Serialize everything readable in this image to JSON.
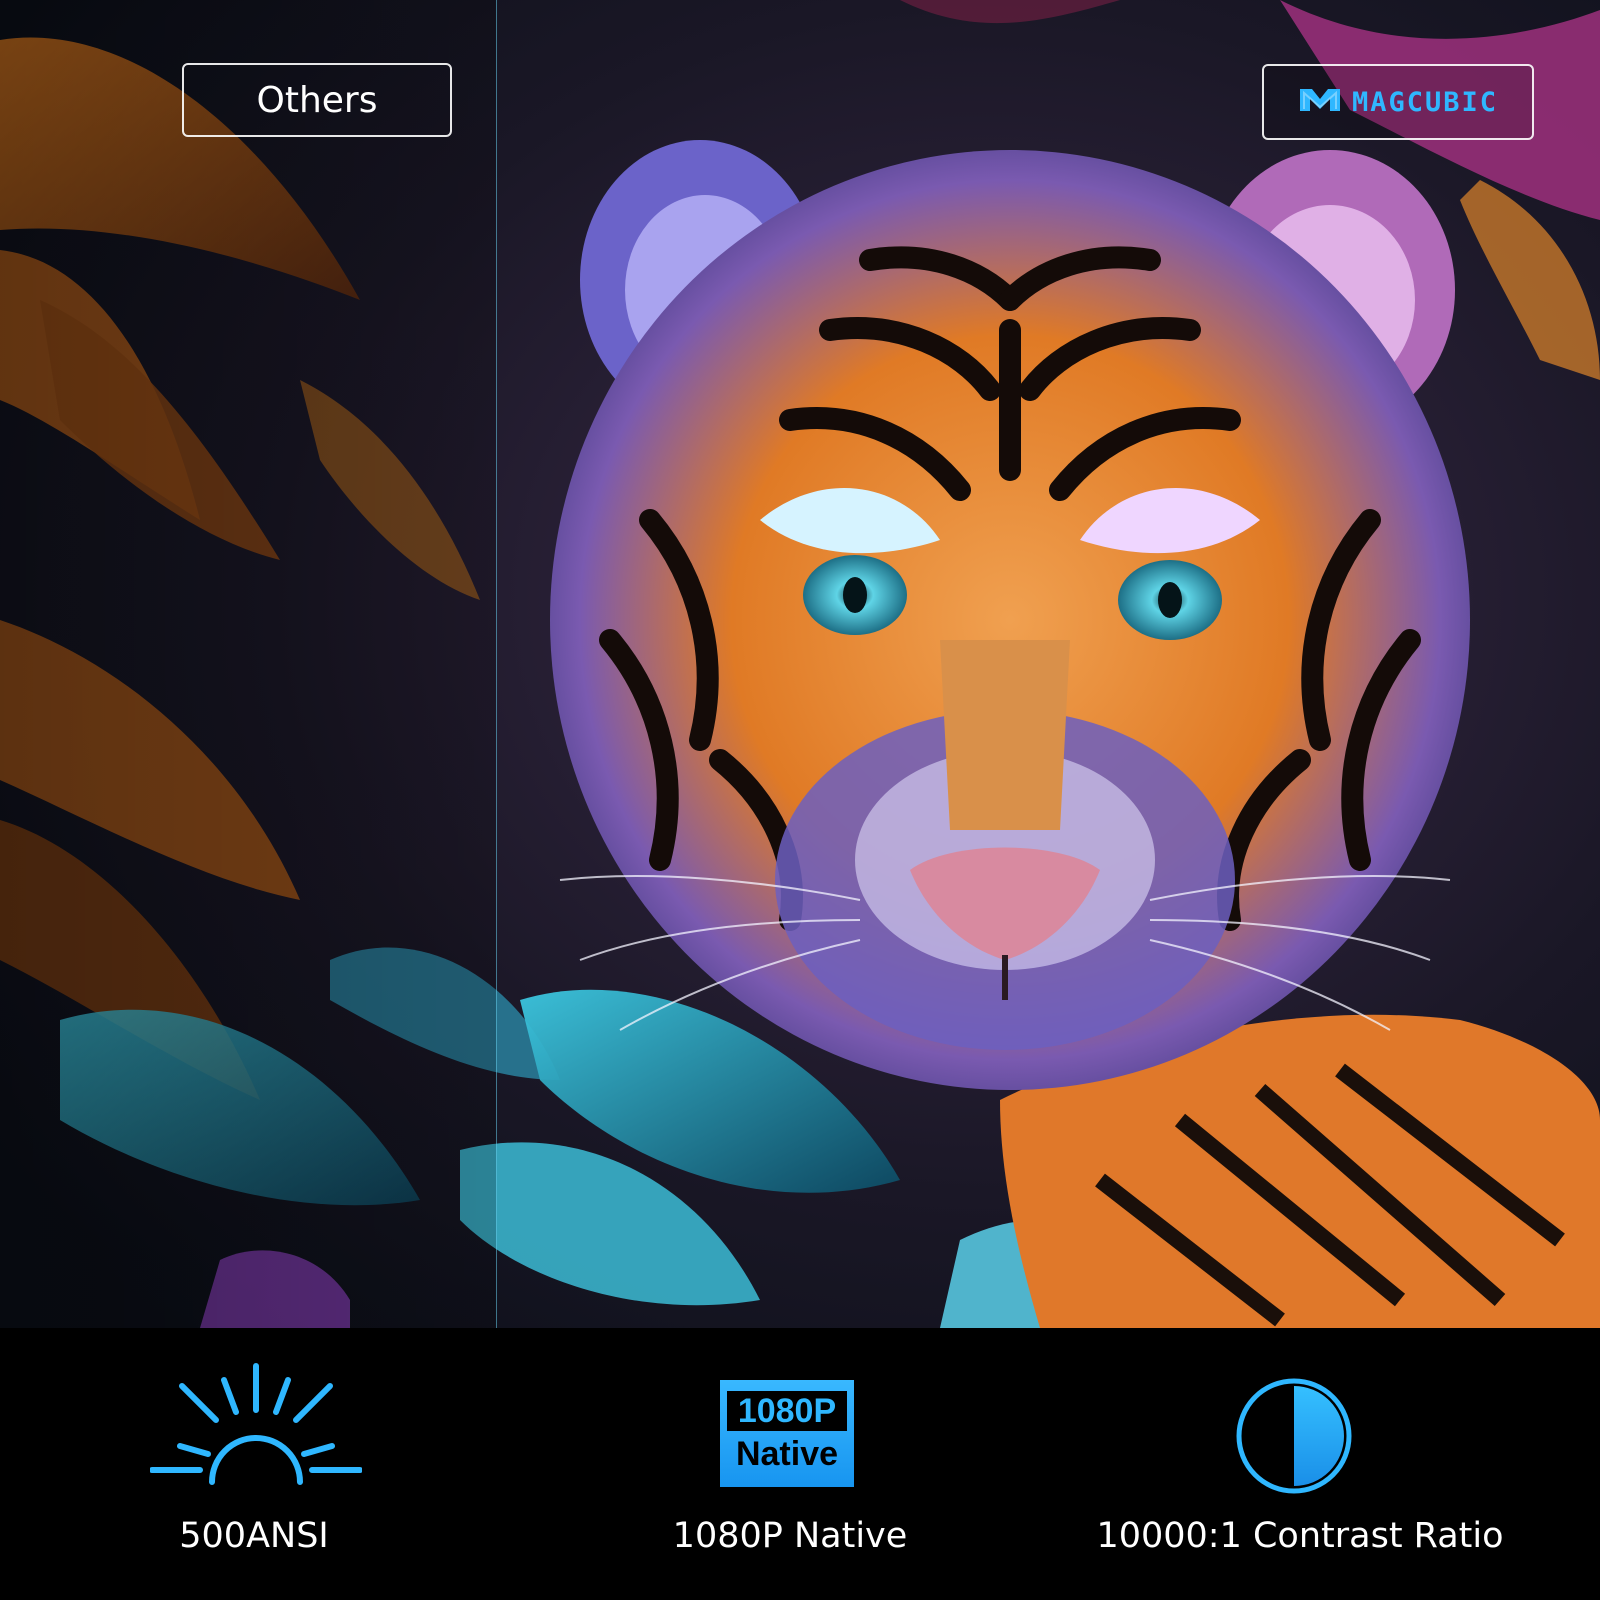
{
  "comparison": {
    "left_label": "Others",
    "brand_name": "MAGCUBIC",
    "brand_color": "#2fb7ff"
  },
  "features": [
    {
      "icon": "sun-icon",
      "label": "500ANSI"
    },
    {
      "icon": "resolution-badge-icon",
      "label": "1080P Native",
      "badge_top": "1080P",
      "badge_bottom": "Native"
    },
    {
      "icon": "contrast-icon",
      "label": "10000:1 Contrast Ratio"
    }
  ],
  "colors": {
    "accent": "#2fb7ff",
    "footer_bg": "#000000"
  }
}
